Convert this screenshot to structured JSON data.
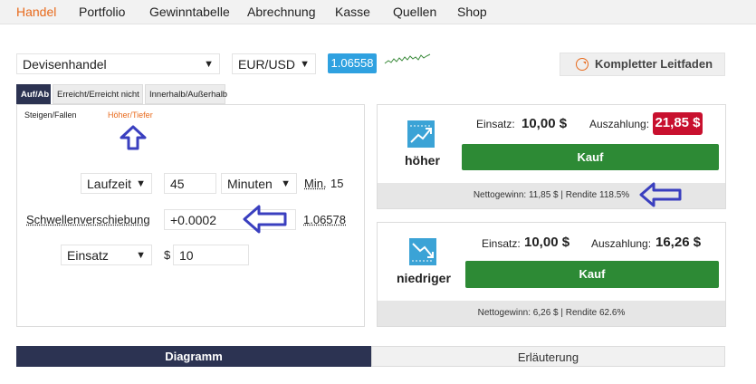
{
  "nav": {
    "items": [
      "Handel",
      "Portfolio",
      "Gewinntabelle",
      "Abrechnung",
      "Kasse",
      "Quellen",
      "Shop"
    ],
    "active": "Handel"
  },
  "toolbar": {
    "market": "Devisenhandel",
    "pair": "EUR/USD",
    "price": "1.06558",
    "guide": "Kompletter Leitfaden"
  },
  "tabs": [
    "Auf/Ab",
    "Erreicht/Erreicht nicht",
    "Innerhalb/Außerhalb"
  ],
  "subtypes": {
    "first": "Steigen/Fallen",
    "second": "Höher/Tiefer"
  },
  "form": {
    "duration_type": "Laufzeit",
    "duration_value": "45",
    "duration_unit": "Minuten",
    "min_label": "Min.",
    "min_value": "15",
    "barrier_label": "Schwellenverschiebung",
    "barrier_value": "+0.0002",
    "barrier_price": "1.06578",
    "amount_type": "Einsatz",
    "currency": "$",
    "amount_value": "10"
  },
  "cards": {
    "higher": {
      "label": "höher",
      "stake_label": "Einsatz:",
      "stake": "10,00 $",
      "payout_label": "Auszahlung:",
      "payout": "21,85 $",
      "buy": "Kauf",
      "footer": "Nettogewinn: 11,85 $ | Rendite 118.5%"
    },
    "lower": {
      "label": "niedriger",
      "stake_label": "Einsatz:",
      "stake": "10,00 $",
      "payout_label": "Auszahlung:",
      "payout": "16,26 $",
      "buy": "Kauf",
      "footer": "Nettogewinn: 6,26 $ | Rendite 62.6%"
    }
  },
  "bottom_tabs": [
    "Diagramm",
    "Erläuterung"
  ],
  "colors": {
    "accent_orange": "#e86a1c",
    "nav_dark": "#2c3352",
    "price_blue": "#2fa1e0",
    "buy_green": "#2d8a35",
    "payout_red": "#c8102e",
    "annotation_arrow": "#3a3fbf"
  }
}
